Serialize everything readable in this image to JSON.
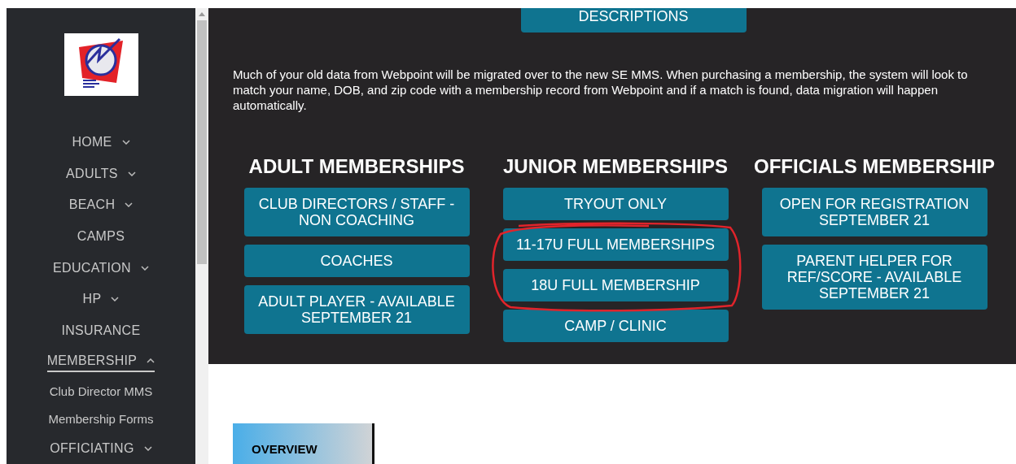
{
  "sidebar": {
    "menu": [
      {
        "label": "HOME",
        "kind": "dropdown",
        "expanded": false,
        "selected": false
      },
      {
        "label": "ADULTS",
        "kind": "dropdown",
        "expanded": false,
        "selected": false
      },
      {
        "label": "BEACH",
        "kind": "dropdown",
        "expanded": false,
        "selected": false
      },
      {
        "label": "CAMPS",
        "kind": "link",
        "selected": false
      },
      {
        "label": "EDUCATION",
        "kind": "dropdown",
        "expanded": false,
        "selected": false
      },
      {
        "label": "HP",
        "kind": "dropdown",
        "expanded": false,
        "selected": false
      },
      {
        "label": "INSURANCE",
        "kind": "link",
        "selected": false
      },
      {
        "label": "MEMBERSHIP",
        "kind": "dropdown",
        "expanded": true,
        "selected": true,
        "children": [
          {
            "label": "Club Director MMS"
          },
          {
            "label": "Membership Forms"
          }
        ]
      },
      {
        "label": "OFFICIATING",
        "kind": "dropdown",
        "expanded": false,
        "selected": false
      }
    ]
  },
  "top_button": "DESCRIPTIONS",
  "intro": "Much of your old data from Webpoint will be migrated over to the new SE MMS. When purchasing a membership, the system will look to match your name, DOB, and zip code with a membership record from Webpoint and if a match is found, data migration will happen automatically.",
  "columns": [
    {
      "heading": "ADULT MEMBERSHIPS",
      "buttons": [
        "CLUB DIRECTORS / STAFF - NON COACHING",
        "COACHES",
        "ADULT PLAYER - AVAILABLE SEPTEMBER 21"
      ]
    },
    {
      "heading": "JUNIOR MEMBERSHIPS",
      "buttons": [
        "TRYOUT ONLY",
        "11-17U FULL MEMBERSHIPS",
        "18U FULL MEMBERSHIP",
        "CAMP / CLINIC"
      ]
    },
    {
      "heading": "OFFICIALS MEMBERSHIP",
      "buttons": [
        "OPEN FOR REGISTRATION SEPTEMBER 21",
        "PARENT HELPER FOR REF/SCORE - AVAILABLE SEPTEMBER 21"
      ]
    }
  ],
  "section_tab": "OVERVIEW"
}
